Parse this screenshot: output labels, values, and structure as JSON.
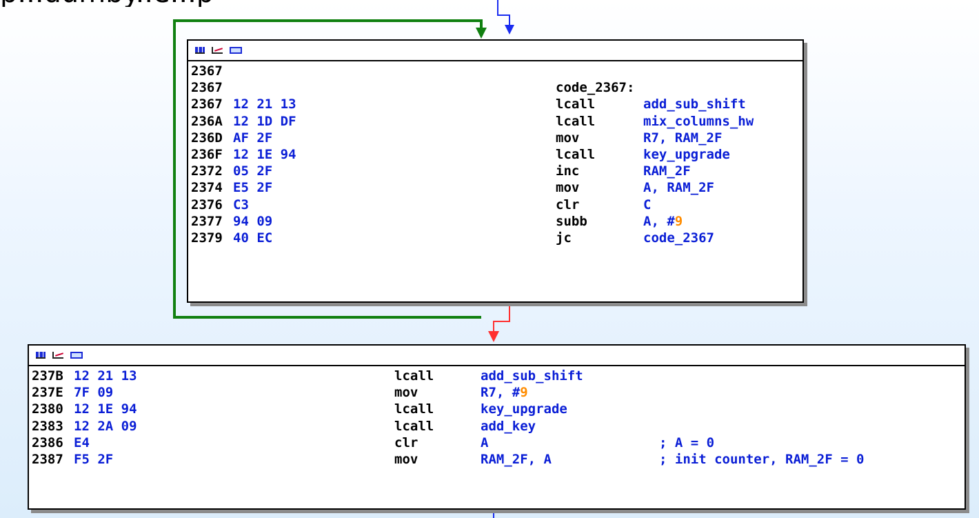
{
  "caption_fragment": "p...dumby..e...p",
  "upper_block": {
    "rows": [
      {
        "addr": "2367",
        "bytes": "",
        "label": "",
        "mnem": "",
        "ops": []
      },
      {
        "addr": "2367",
        "bytes": "",
        "label": "code_2367:",
        "mnem": "",
        "ops": []
      },
      {
        "addr": "2367",
        "bytes": "12 21 13",
        "mnem": "lcall",
        "ops": [
          {
            "t": "add_sub_shift"
          }
        ]
      },
      {
        "addr": "236A",
        "bytes": "12 1D DF",
        "mnem": "lcall",
        "ops": [
          {
            "t": "mix_columns_hw"
          }
        ]
      },
      {
        "addr": "236D",
        "bytes": "AF 2F",
        "mnem": "mov",
        "ops": [
          {
            "t": "R7, RAM_2F"
          }
        ]
      },
      {
        "addr": "236F",
        "bytes": "12 1E 94",
        "mnem": "lcall",
        "ops": [
          {
            "t": "key_upgrade"
          }
        ]
      },
      {
        "addr": "2372",
        "bytes": "05 2F",
        "mnem": "inc",
        "ops": [
          {
            "t": "RAM_2F"
          }
        ]
      },
      {
        "addr": "2374",
        "bytes": "E5 2F",
        "mnem": "mov",
        "ops": [
          {
            "t": "A, RAM_2F"
          }
        ]
      },
      {
        "addr": "2376",
        "bytes": "C3",
        "mnem": "clr",
        "ops": [
          {
            "t": "C"
          }
        ]
      },
      {
        "addr": "2377",
        "bytes": "94 09",
        "mnem": "subb",
        "ops": [
          {
            "t": "A, #"
          },
          {
            "t": "9",
            "num": true
          }
        ]
      },
      {
        "addr": "2379",
        "bytes": "40 EC",
        "mnem": "jc",
        "ops": [
          {
            "t": "code_2367"
          }
        ]
      }
    ]
  },
  "lower_block": {
    "rows": [
      {
        "addr": "237B",
        "bytes": "12 21 13",
        "mnem": "lcall",
        "ops": [
          {
            "t": "add_sub_shift"
          }
        ],
        "comment": ""
      },
      {
        "addr": "237E",
        "bytes": "7F 09",
        "mnem": "mov",
        "ops": [
          {
            "t": "R7, #"
          },
          {
            "t": "9",
            "num": true
          }
        ],
        "comment": ""
      },
      {
        "addr": "2380",
        "bytes": "12 1E 94",
        "mnem": "lcall",
        "ops": [
          {
            "t": "key_upgrade"
          }
        ],
        "comment": ""
      },
      {
        "addr": "2383",
        "bytes": "12 2A 09",
        "mnem": "lcall",
        "ops": [
          {
            "t": "add_key"
          }
        ],
        "comment": ""
      },
      {
        "addr": "2386",
        "bytes": "E4",
        "mnem": "clr",
        "ops": [
          {
            "t": "A"
          }
        ],
        "comment": "; A = 0"
      },
      {
        "addr": "2387",
        "bytes": "F5 2F",
        "mnem": "mov",
        "ops": [
          {
            "t": "RAM_2F, A"
          }
        ],
        "comment": "; init counter, RAM_2F = 0"
      }
    ]
  },
  "edges": {
    "loop_color": "#108010",
    "fallthrough_color": "#ff3030",
    "incoming_color": "#1a2cf0"
  }
}
